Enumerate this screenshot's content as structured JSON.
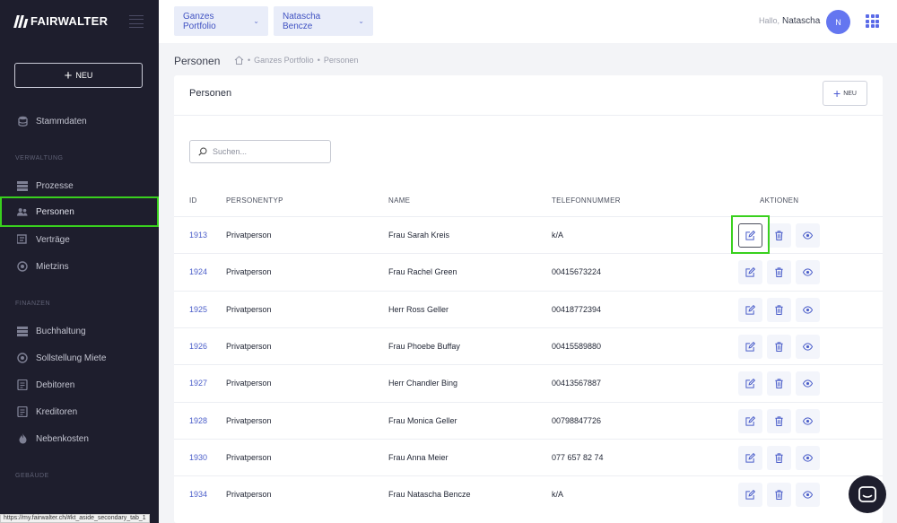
{
  "brand": {
    "name": "FAIRWALTER"
  },
  "sidebar": {
    "new_label": "NEU",
    "items": [
      {
        "label": "Stammdaten"
      },
      {
        "label": "Prozesse"
      },
      {
        "label": "Personen"
      },
      {
        "label": "Verträge"
      },
      {
        "label": "Mietzins"
      },
      {
        "label": "Buchhaltung"
      },
      {
        "label": "Sollstellung Miete"
      },
      {
        "label": "Debitoren"
      },
      {
        "label": "Kreditoren"
      },
      {
        "label": "Nebenkosten"
      }
    ],
    "sections": {
      "verwaltung": "VERWALTUNG",
      "finanzen": "FINANZEN",
      "gebaeude": "GEBÄUDE"
    },
    "active_item": "Personen"
  },
  "topbar": {
    "portfolio_select": "Ganzes Portfolio",
    "user_select": "Natascha Bencze",
    "greeting": "Hallo,",
    "user_name": "Natascha",
    "avatar_initial": "N"
  },
  "page": {
    "title": "Personen",
    "breadcrumb": [
      "Ganzes Portfolio",
      "Personen"
    ]
  },
  "card": {
    "title": "Personen",
    "new_label": "NEU",
    "search_placeholder": "Suchen..."
  },
  "table": {
    "headers": {
      "id": "ID",
      "type": "PERSONENTYP",
      "name": "NAME",
      "phone": "TELEFONNUMMER",
      "actions": "AKTIONEN"
    },
    "rows": [
      {
        "id": "1913",
        "type": "Privatperson",
        "name": "Frau Sarah Kreis",
        "phone": "k/A"
      },
      {
        "id": "1924",
        "type": "Privatperson",
        "name": "Frau Rachel Green",
        "phone": "00415673224"
      },
      {
        "id": "1925",
        "type": "Privatperson",
        "name": "Herr Ross Geller",
        "phone": "00418772394"
      },
      {
        "id": "1926",
        "type": "Privatperson",
        "name": "Frau Phoebe Buffay",
        "phone": "00415589880"
      },
      {
        "id": "1927",
        "type": "Privatperson",
        "name": "Herr Chandler Bing",
        "phone": "00413567887"
      },
      {
        "id": "1928",
        "type": "Privatperson",
        "name": "Frau Monica Geller",
        "phone": "00798847726"
      },
      {
        "id": "1930",
        "type": "Privatperson",
        "name": "Frau Anna Meier",
        "phone": "077 657 82 74"
      },
      {
        "id": "1934",
        "type": "Privatperson",
        "name": "Frau Natascha Bencze",
        "phone": "k/A"
      }
    ]
  },
  "status_bar": {
    "url": "https://my.fairwalter.ch/#kt_aside_secondary_tab_1"
  },
  "colors": {
    "accent": "#4a5dc9",
    "sidebar_bg": "#1e1e2d",
    "highlight": "#39d01e",
    "avatar": "#6476f0"
  },
  "icons": [
    "database-icon",
    "list-icon",
    "users-icon",
    "layers-icon",
    "coins-icon",
    "calculator-icon",
    "document-icon",
    "home-icon",
    "edit-icon",
    "trash-icon",
    "eye-icon",
    "chat-icon",
    "apps-grid-icon",
    "search-icon"
  ]
}
